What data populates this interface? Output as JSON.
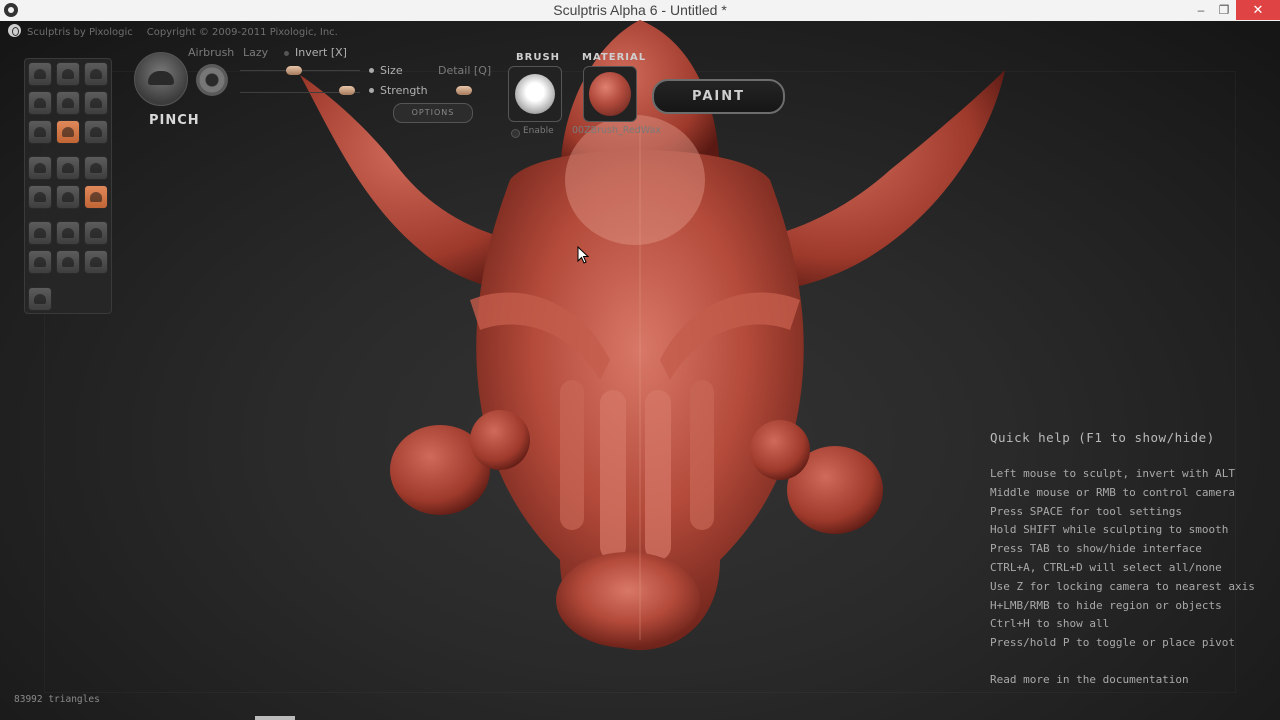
{
  "window": {
    "title": "Sculptris Alpha 6 - Untitled *",
    "min": "–",
    "max": "❐",
    "close": "✕"
  },
  "brand": {
    "app": "Sculptris by Pixologic",
    "copyright": "Copyright © 2009-2011 Pixologic, Inc."
  },
  "toolbar": {
    "brush_name": "PINCH",
    "airbrush": "Airbrush",
    "lazy": "Lazy",
    "invert": "Invert [X]",
    "size": "Size",
    "detail": "Detail [Q]",
    "strength": "Strength",
    "options": "OPTIONS",
    "brush_header": "BRUSH",
    "material_header": "MATERIAL",
    "enable": "Enable",
    "material_name": "00ZBrush_RedWax",
    "paint": "PAINT"
  },
  "tools": [
    {
      "name": "draw-tool-icon",
      "active": false
    },
    {
      "name": "rotate-tool-icon",
      "active": false
    },
    {
      "name": "crop-tool-icon",
      "active": false
    },
    {
      "name": "inflate-tool-icon",
      "active": false
    },
    {
      "name": "flatten-tool-icon",
      "active": false
    },
    {
      "name": "grab-tool-icon",
      "active": false
    },
    {
      "name": "smooth-tool-icon",
      "active": false
    },
    {
      "name": "pinch-tool-icon",
      "active": true
    },
    {
      "name": "crease-tool-icon",
      "active": false
    },
    {
      "name": "reduce-tool-icon",
      "active": false
    },
    {
      "name": "cut-tool-icon",
      "active": false
    },
    {
      "name": "mask-tool-icon",
      "active": false
    },
    {
      "name": "scale-tool-icon",
      "active": false
    },
    {
      "name": "wireframe-tool-icon",
      "active": false
    },
    {
      "name": "symmetry-tool-icon",
      "active": true
    },
    {
      "name": "sphere-tool-icon",
      "active": false
    },
    {
      "name": "plane-tool-icon",
      "active": false
    },
    {
      "name": "import-tool-icon",
      "active": false
    },
    {
      "name": "export-tool-icon",
      "active": false
    },
    {
      "name": "save-tool-icon",
      "active": false
    },
    {
      "name": "settings-tool-icon",
      "active": false
    },
    {
      "name": "goz-tool-icon",
      "active": false
    }
  ],
  "quick_help": {
    "title": "Quick help (F1 to show/hide)",
    "lines": [
      "Left mouse to sculpt, invert with ALT",
      "Middle mouse or RMB to control camera",
      "Press SPACE for tool settings",
      "Hold SHIFT while sculpting to smooth",
      "Press TAB to show/hide interface",
      "CTRL+A, CTRL+D will select all/none",
      "Use Z for locking camera to nearest axis",
      "H+LMB/RMB to hide region or objects",
      "Ctrl+H to show all",
      "Press/hold P to toggle or place pivot"
    ],
    "doc_link": "Read more in the documentation"
  },
  "status": {
    "triangles": "83992 triangles"
  }
}
